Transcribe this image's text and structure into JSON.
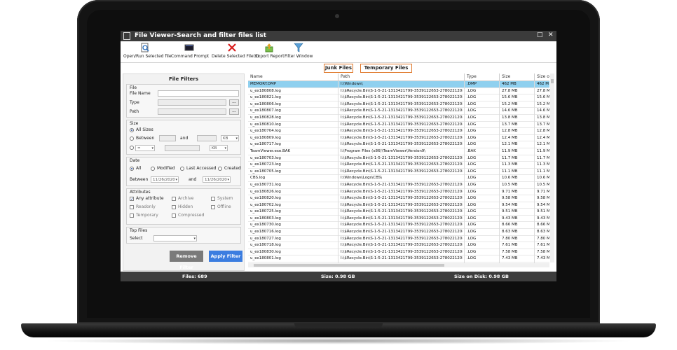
{
  "window": {
    "title": "File Viewer-Search and filter files list",
    "controls": [
      "□",
      "✕"
    ]
  },
  "toolbar": [
    {
      "label": "Open/Run Selected file",
      "icon": "search-document-icon"
    },
    {
      "label": "Command Prompt",
      "icon": "terminal-icon"
    },
    {
      "label": "Delete Selected File(s)",
      "icon": "red-x-icon"
    },
    {
      "label": "Export Report",
      "icon": "export-icon"
    },
    {
      "label": "Filter Window",
      "icon": "funnel-icon"
    }
  ],
  "quick_tabs": [
    "Junk Files",
    "Temporary Files"
  ],
  "filters": {
    "title": "File Filters",
    "file": {
      "heading": "File",
      "name_label": "File Name",
      "type_label": "Type",
      "path_label": "Path",
      "browse": "..."
    },
    "size": {
      "heading": "Size",
      "all_sizes": "All Sizes",
      "between": "Between",
      "and": "and",
      "unit1": "KB",
      "unit2": "KB",
      "op": "="
    },
    "date": {
      "heading": "Date",
      "all": "All",
      "modified": "Modified",
      "last_accessed": "Last Accessed",
      "created": "Created",
      "between": "Between",
      "and": "and",
      "from": "11/26/2020",
      "to": "11/26/2020"
    },
    "attributes": {
      "heading": "Attributes",
      "items": [
        "Any attribute",
        "Archive",
        "System",
        "Readonly",
        "Hidden",
        "Offline",
        "Temporary",
        "Compressed"
      ]
    },
    "top_files": {
      "heading": "Top Files",
      "select_label": "Select"
    },
    "remove_button": "Remove Filter",
    "apply_button": "Apply Filter"
  },
  "grid": {
    "columns": [
      "Name",
      "Path",
      "Type",
      "Size",
      "Size o"
    ],
    "rows": [
      {
        "name": "MEMORY.DMP",
        "path": "I:\\Windows\\",
        "type": ".DMP",
        "size": "462 MB",
        "disk": "462 M"
      },
      {
        "name": "u_ex180808.log",
        "path": "I:\\$Recycle.Bin\\S-1-5-21-1313421799-3539122653-2780221208-1...",
        "type": ".LOG",
        "size": "27.8 MB",
        "disk": "27.8 M"
      },
      {
        "name": "u_ex180821.log",
        "path": "I:\\$Recycle.Bin\\S-1-5-21-1313421799-3539122653-2780221208-1...",
        "type": ".LOG",
        "size": "15.6 MB",
        "disk": "15.6 M"
      },
      {
        "name": "u_ex180806.log",
        "path": "I:\\$Recycle.Bin\\S-1-5-21-1313421799-3539122653-2780221208-1...",
        "type": ".LOG",
        "size": "15.2 MB",
        "disk": "15.2 M"
      },
      {
        "name": "u_ex180807.log",
        "path": "I:\\$Recycle.Bin\\S-1-5-21-1313421799-3539122653-2780221208-1...",
        "type": ".LOG",
        "size": "14.6 MB",
        "disk": "14.6 M"
      },
      {
        "name": "u_ex180828.log",
        "path": "I:\\$Recycle.Bin\\S-1-5-21-1313421799-3539122653-2780221208-1...",
        "type": ".LOG",
        "size": "13.8 MB",
        "disk": "13.8 M"
      },
      {
        "name": "u_ex180810.log",
        "path": "I:\\$Recycle.Bin\\S-1-5-21-1313421799-3539122653-2780221208-1...",
        "type": ".LOG",
        "size": "13.7 MB",
        "disk": "13.7 M"
      },
      {
        "name": "u_ex180704.log",
        "path": "I:\\$Recycle.Bin\\S-1-5-21-1313421799-3539122653-2780221208-1...",
        "type": ".LOG",
        "size": "12.8 MB",
        "disk": "12.8 M"
      },
      {
        "name": "u_ex180809.log",
        "path": "I:\\$Recycle.Bin\\S-1-5-21-1313421799-3539122653-2780221208-1...",
        "type": ".LOG",
        "size": "12.4 MB",
        "disk": "12.4 M"
      },
      {
        "name": "u_ex180717.log",
        "path": "I:\\$Recycle.Bin\\S-1-5-21-1313421799-3539122653-2780221208-1...",
        "type": ".LOG",
        "size": "12.1 MB",
        "disk": "12.1 M"
      },
      {
        "name": "TeamViewer.exe.BAK",
        "path": "I:\\Program Files (x86)\\TeamViewer\\Version9\\",
        "type": ".BAK",
        "size": "11.9 MB",
        "disk": "11.9 M"
      },
      {
        "name": "u_ex180703.log",
        "path": "I:\\$Recycle.Bin\\S-1-5-21-1313421799-3539122653-2780221208-1...",
        "type": ".LOG",
        "size": "11.7 MB",
        "disk": "11.7 M"
      },
      {
        "name": "u_ex180723.log",
        "path": "I:\\$Recycle.Bin\\S-1-5-21-1313421799-3539122653-2780221208-1...",
        "type": ".LOG",
        "size": "11.3 MB",
        "disk": "11.3 M"
      },
      {
        "name": "u_ex180705.log",
        "path": "I:\\$Recycle.Bin\\S-1-5-21-1313421799-3539122653-2780221208-1...",
        "type": ".LOG",
        "size": "11.1 MB",
        "disk": "11.1 M"
      },
      {
        "name": "CBS.log",
        "path": "I:\\Windows\\Logs\\CBS\\",
        "type": ".LOG",
        "size": "10.6 MB",
        "disk": "10.6 M"
      },
      {
        "name": "u_ex180731.log",
        "path": "I:\\$Recycle.Bin\\S-1-5-21-1313421799-3539122653-2780221208-1...",
        "type": ".LOG",
        "size": "10.5 MB",
        "disk": "10.5 M"
      },
      {
        "name": "u_ex180826.log",
        "path": "I:\\$Recycle.Bin\\S-1-5-21-1313421799-3539122653-2780221208-1...",
        "type": ".LOG",
        "size": "9.71 MB",
        "disk": "9.71 M"
      },
      {
        "name": "u_ex180820.log",
        "path": "I:\\$Recycle.Bin\\S-1-5-21-1313421799-3539122653-2780221208-1...",
        "type": ".LOG",
        "size": "9.58 MB",
        "disk": "9.58 M"
      },
      {
        "name": "u_ex180702.log",
        "path": "I:\\$Recycle.Bin\\S-1-5-21-1313421799-3539122653-2780221208-1...",
        "type": ".LOG",
        "size": "9.54 MB",
        "disk": "9.54 M"
      },
      {
        "name": "u_ex180725.log",
        "path": "I:\\$Recycle.Bin\\S-1-5-21-1313421799-3539122653-2780221208-1...",
        "type": ".LOG",
        "size": "9.51 MB",
        "disk": "9.51 M"
      },
      {
        "name": "u_ex180803.log",
        "path": "I:\\$Recycle.Bin\\S-1-5-21-1313421799-3539122653-2780221208-1...",
        "type": ".LOG",
        "size": "9.43 MB",
        "disk": "9.43 M"
      },
      {
        "name": "u_ex180730.log",
        "path": "I:\\$Recycle.Bin\\S-1-5-21-1313421799-3539122653-2780221208-1...",
        "type": ".LOG",
        "size": "8.66 MB",
        "disk": "8.66 M"
      },
      {
        "name": "u_ex180716.log",
        "path": "I:\\$Recycle.Bin\\S-1-5-21-1313421799-3539122653-2780221208-1...",
        "type": ".LOG",
        "size": "8.63 MB",
        "disk": "8.63 M"
      },
      {
        "name": "u_ex180727.log",
        "path": "I:\\$Recycle.Bin\\S-1-5-21-1313421799-3539122653-2780221208-1...",
        "type": ".LOG",
        "size": "7.80 MB",
        "disk": "7.80 M"
      },
      {
        "name": "u_ex180718.log",
        "path": "I:\\$Recycle.Bin\\S-1-5-21-1313421799-3539122653-2780221208-1...",
        "type": ".LOG",
        "size": "7.61 MB",
        "disk": "7.61 M"
      },
      {
        "name": "u_ex180830.log",
        "path": "I:\\$Recycle.Bin\\S-1-5-21-1313421799-3539122653-2780221208-1...",
        "type": ".LOG",
        "size": "7.58 MB",
        "disk": "7.58 M"
      },
      {
        "name": "u_ex180801.log",
        "path": "I:\\$Recycle.Bin\\S-1-5-21-1313421799-3539122653-2780221208-1...",
        "type": ".LOG",
        "size": "7.43 MB",
        "disk": "7.43 M"
      },
      {
        "name": "u_ex180724.log",
        "path": "I:\\$Recycle.Bin\\S-1-5-21-1313421799-3539122653-2780221208-1...",
        "type": ".LOG",
        "size": "7.11 MB",
        "disk": "7.11 M"
      }
    ]
  },
  "status": {
    "files": "Files: 689",
    "size": "Size: 0.98 GB",
    "disk": "Size on Disk: 0.98 GB"
  },
  "colors": {
    "titlebar": "#3b3b3b",
    "selected_row": "#8fd0ef",
    "apply_button": "#3b7de0",
    "remove_button": "#7a7a7a",
    "tab_border": "#e07a2e"
  }
}
